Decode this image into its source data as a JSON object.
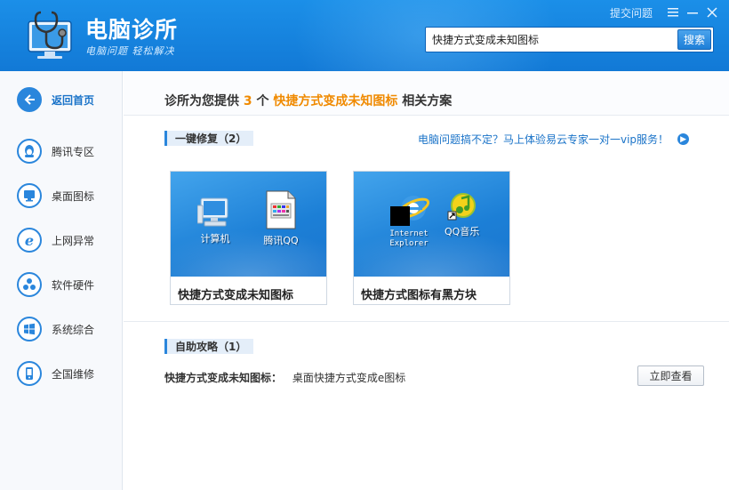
{
  "header": {
    "title": "电脑诊所",
    "slogan": "电脑问题 轻松解决",
    "submit_link": "提交问题",
    "menu_icon": "menu-icon",
    "minimize_icon": "minimize-icon",
    "close_icon": "close-icon"
  },
  "search": {
    "value": "快捷方式变成未知图标",
    "button_label": "搜索"
  },
  "sidebar": {
    "items": [
      {
        "label": "返回首页",
        "icon": "back-arrow-icon"
      },
      {
        "label": "腾讯专区",
        "icon": "qq-penguin-icon"
      },
      {
        "label": "桌面图标",
        "icon": "monitor-icon"
      },
      {
        "label": "上网异常",
        "icon": "ie-browser-icon"
      },
      {
        "label": "软件硬件",
        "icon": "hardware-icon"
      },
      {
        "label": "系统综合",
        "icon": "windows-logo-icon"
      },
      {
        "label": "全国维修",
        "icon": "phone-icon"
      }
    ]
  },
  "main": {
    "headline": {
      "prefix": "诊所为您提供",
      "count": "3",
      "unit": "个",
      "keyword": "快捷方式变成未知图标",
      "suffix": "相关方案"
    },
    "repair_section": {
      "label": "一键修复（2）",
      "vip_link": "电脑问题搞不定？马上体验易云专家一对一vip服务！"
    },
    "cards": [
      {
        "title": "快捷方式变成未知图标",
        "icon1_label": "计算机",
        "icon2_label": "腾讯QQ"
      },
      {
        "title": "快捷方式图标有黑方块",
        "icon1_label": "Internet Explorer",
        "icon2_label": "QQ音乐"
      }
    ],
    "guide_section": {
      "label": "自助攻略（1）",
      "item_label": "快捷方式变成未知图标：",
      "item_link": "桌面快捷方式变成e图标",
      "button_label": "立即查看"
    }
  },
  "colors": {
    "header_blue": "#1b8fe8",
    "accent_blue": "#2a86dc",
    "highlight_orange": "#f08a00"
  }
}
